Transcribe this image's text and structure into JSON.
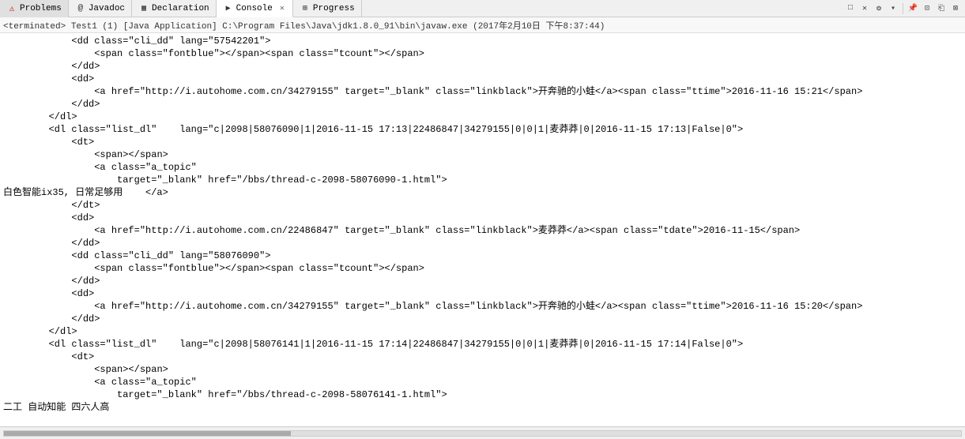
{
  "tabs": [
    {
      "id": "problems",
      "label": "Problems",
      "icon": "⚠",
      "active": false,
      "closeable": false,
      "iconClass": "icon-problems"
    },
    {
      "id": "javadoc",
      "label": "Javadoc",
      "icon": "@",
      "active": false,
      "closeable": false,
      "iconClass": "icon-javadoc"
    },
    {
      "id": "declaration",
      "label": "Declaration",
      "icon": "▦",
      "active": false,
      "closeable": false,
      "iconClass": "icon-declaration"
    },
    {
      "id": "console",
      "label": "Console",
      "icon": "▶",
      "active": true,
      "closeable": true,
      "iconClass": "icon-console"
    },
    {
      "id": "progress",
      "label": "Progress",
      "icon": "⟳",
      "active": false,
      "closeable": false,
      "iconClass": "icon-progress"
    }
  ],
  "action_buttons": [
    "□",
    "✕",
    "❂",
    "⊞",
    "⎘",
    "⊠",
    "⊡",
    "⎗"
  ],
  "status_bar": {
    "text": "<terminated> Test1 (1) [Java Application] C:\\Program Files\\Java\\jdk1.8.0_91\\bin\\javaw.exe (2017年2月10日 下午8:37:44)"
  },
  "code_lines": [
    {
      "indent": "            ",
      "content": "<dd class=\"cli_dd\" lang=\"57542201\">"
    },
    {
      "indent": "                ",
      "content": "<span class=\"fontblue\"></span><span class=\"tcount\"></span>"
    },
    {
      "indent": "            ",
      "content": "</dd>"
    },
    {
      "indent": "            ",
      "content": "<dd>"
    },
    {
      "indent": "                ",
      "content": "<a href=\"http://i.autohome.com.cn/34279155\" target=\"_blank\" class=\"linkblack\">开奔驰的小蛙</a><span class=\"ttime\">2016-11-16 15:21</span>"
    },
    {
      "indent": "            ",
      "content": "</dd>"
    },
    {
      "indent": "        ",
      "content": "</dl>"
    },
    {
      "indent": "        ",
      "content": "<dl class=\"list_dl\"    lang=\"c|2098|58076090|1|2016-11-15 17:13|22486847|34279155|0|0|1|麦莽莽|0|2016-11-15 17:13|False|0\">"
    },
    {
      "indent": "            ",
      "content": "<dt>"
    },
    {
      "indent": "                ",
      "content": "<span></span>"
    },
    {
      "indent": "                ",
      "content": "<a class=\"a_topic\""
    },
    {
      "indent": "                    ",
      "content": "target=\"_blank\" href=\"/bbs/thread-c-2098-58076090-1.html\">"
    },
    {
      "indent": "",
      "content": "白色智能ix35, 日常足够用    </a>"
    },
    {
      "indent": "            ",
      "content": "</dt>"
    },
    {
      "indent": "            ",
      "content": "<dd>"
    },
    {
      "indent": "                ",
      "content": "<a href=\"http://i.autohome.com.cn/22486847\" target=\"_blank\" class=\"linkblack\">麦莽莽</a><span class=\"tdate\">2016-11-15</span>"
    },
    {
      "indent": "            ",
      "content": "</dd>"
    },
    {
      "indent": "            ",
      "content": "<dd class=\"cli_dd\" lang=\"58076090\">"
    },
    {
      "indent": "                ",
      "content": "<span class=\"fontblue\"></span><span class=\"tcount\"></span>"
    },
    {
      "indent": "            ",
      "content": "</dd>"
    },
    {
      "indent": "            ",
      "content": "<dd>"
    },
    {
      "indent": "                ",
      "content": "<a href=\"http://i.autohome.com.cn/34279155\" target=\"_blank\" class=\"linkblack\">开奔驰的小蛙</a><span class=\"ttime\">2016-11-16 15:20</span>"
    },
    {
      "indent": "            ",
      "content": "</dd>"
    },
    {
      "indent": "        ",
      "content": "</dl>"
    },
    {
      "indent": "        ",
      "content": "<dl class=\"list_dl\"    lang=\"c|2098|58076141|1|2016-11-15 17:14|22486847|34279155|0|0|1|麦莽莽|0|2016-11-15 17:14|False|0\">"
    },
    {
      "indent": "            ",
      "content": "<dt>"
    },
    {
      "indent": "                ",
      "content": "<span></span>"
    },
    {
      "indent": "                ",
      "content": "<a class=\"a_topic\""
    },
    {
      "indent": "                    ",
      "content": "target=\"_blank\" href=\"/bbs/thread-c-2098-58076141-1.html\">"
    },
    {
      "indent": "",
      "content": "二工 自动知能 四六人高"
    }
  ]
}
